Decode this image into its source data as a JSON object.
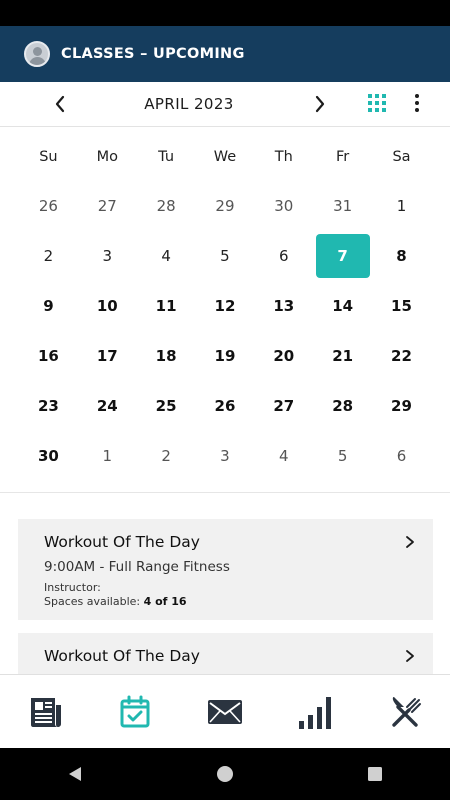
{
  "header": {
    "title": "CLASSES – UPCOMING"
  },
  "month_bar": {
    "month": "APRIL 2023"
  },
  "calendar": {
    "weekdays": [
      "Su",
      "Mo",
      "Tu",
      "We",
      "Th",
      "Fr",
      "Sa"
    ],
    "weeks": [
      [
        "26",
        "27",
        "28",
        "29",
        "30",
        "31",
        "1"
      ],
      [
        "2",
        "3",
        "4",
        "5",
        "6",
        "7",
        "8"
      ],
      [
        "9",
        "10",
        "11",
        "12",
        "13",
        "14",
        "15"
      ],
      [
        "16",
        "17",
        "18",
        "19",
        "20",
        "21",
        "22"
      ],
      [
        "23",
        "24",
        "25",
        "26",
        "27",
        "28",
        "29"
      ],
      [
        "30",
        "1",
        "2",
        "3",
        "4",
        "5",
        "6"
      ]
    ],
    "selected_day": "7",
    "accent_color": "#20b8b0"
  },
  "classes": [
    {
      "title": "Workout Of The Day",
      "time": "9:00AM - Full Range Fitness",
      "instructor_label": "Instructor:",
      "spaces_label": "Spaces available:",
      "spaces_value": "4 of 16"
    },
    {
      "title": "Workout Of The Day"
    }
  ],
  "bottom_nav": {
    "items": [
      "news-icon",
      "calendar-check-icon",
      "mail-icon",
      "bar-chart-icon",
      "fork-knife-icon"
    ],
    "active": "calendar-check-icon"
  },
  "colors": {
    "header_bg": "#153d5e",
    "accent": "#20b8b0",
    "icon_dark": "#2b3440"
  }
}
